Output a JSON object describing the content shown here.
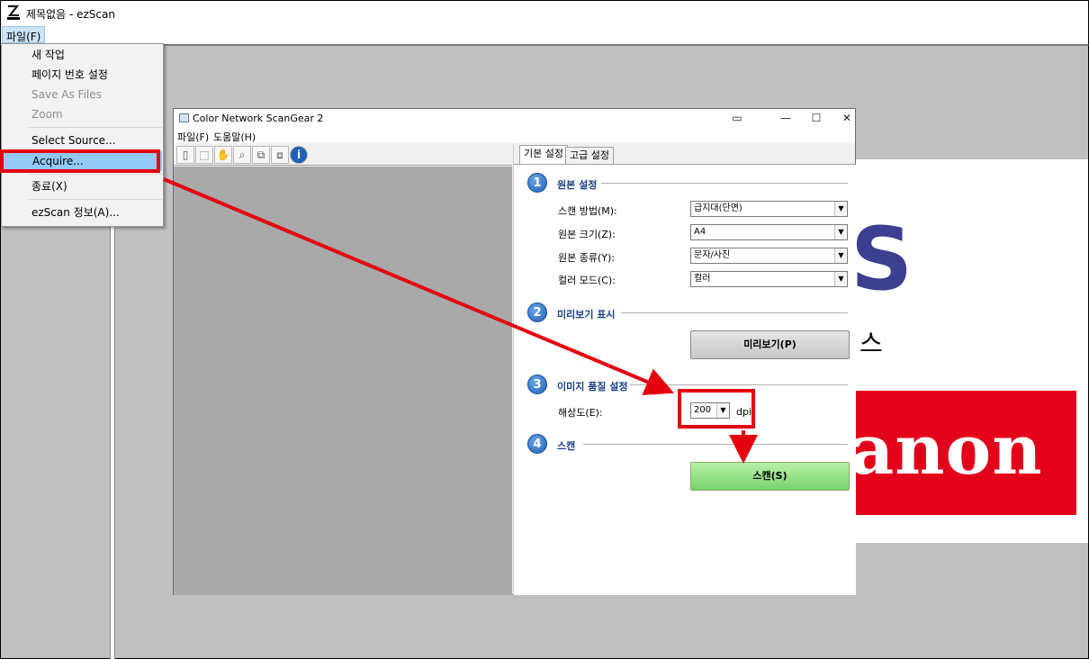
{
  "outer_window": {
    "title": "제목없음 - ezScan",
    "menu_file": "파일(F)"
  },
  "file_menu": {
    "items": [
      {
        "label": "새 작업",
        "enabled": true
      },
      {
        "label": "페이지 번호 설정",
        "enabled": true
      },
      {
        "label": "Save As Files",
        "enabled": false
      },
      {
        "label": "Zoom",
        "enabled": false
      },
      {
        "label": "Select Source...",
        "enabled": true
      },
      {
        "label": "Acquire...",
        "enabled": true,
        "highlighted": true
      },
      {
        "label": "종료(X)",
        "enabled": true
      },
      {
        "label": "ezScan 정보(A)...",
        "enabled": true
      }
    ]
  },
  "document_preview": {
    "letter": "S",
    "korean_fragment": "스",
    "brand": "anon"
  },
  "scangear": {
    "title": "Color Network ScanGear 2",
    "menu": [
      "파일(F)",
      "도움말(H)"
    ],
    "toolbar_icons": [
      "new-page-icon",
      "select-area-icon",
      "hand-icon",
      "zoom-icon",
      "crop-icon",
      "rotate-icon",
      "info-icon"
    ],
    "tabs": [
      "기본 설정",
      "고급 설정"
    ],
    "sections": [
      {
        "num": "1",
        "title": "원본 설정"
      },
      {
        "num": "2",
        "title": "미리보기 표시"
      },
      {
        "num": "3",
        "title": "이미지 품질 설정"
      },
      {
        "num": "4",
        "title": "스캔"
      }
    ],
    "fields": {
      "scan_method": {
        "label": "스캔 방법(M):",
        "value": "급지대(단면)"
      },
      "original_size": {
        "label": "원본 크기(Z):",
        "value": "A4"
      },
      "original_type": {
        "label": "원본 종류(Y):",
        "value": "문자/사진"
      },
      "color_mode": {
        "label": "컬러 모드(C):",
        "value": "컬러"
      },
      "resolution": {
        "label": "해상도(E):",
        "value": "200",
        "unit": "dpi"
      }
    },
    "preview_button": "미리보기(P)",
    "scan_button": "스캔(S)"
  },
  "colors": {
    "annotation_red": "#e4000f",
    "menu_highlight": "#91c9f7",
    "scan_button_green": "#8fe07f",
    "section_blue": "#1f5fb5"
  }
}
